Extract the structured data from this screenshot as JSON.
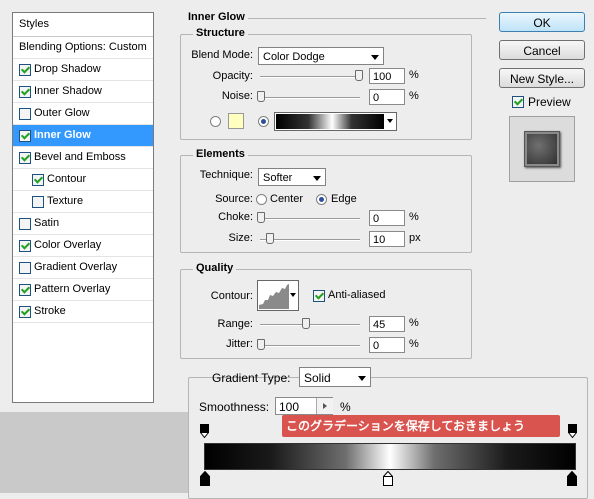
{
  "styles_panel": {
    "header": "Styles",
    "items": [
      {
        "label": "Blending Options: Custom",
        "checkbox": false,
        "checked": false,
        "indent": 0,
        "selected": false
      },
      {
        "label": "Drop Shadow",
        "checkbox": true,
        "checked": true,
        "indent": 1,
        "selected": false
      },
      {
        "label": "Inner Shadow",
        "checkbox": true,
        "checked": true,
        "indent": 1,
        "selected": false
      },
      {
        "label": "Outer Glow",
        "checkbox": true,
        "checked": false,
        "indent": 1,
        "selected": false
      },
      {
        "label": "Inner Glow",
        "checkbox": true,
        "checked": true,
        "indent": 1,
        "selected": true
      },
      {
        "label": "Bevel and Emboss",
        "checkbox": true,
        "checked": true,
        "indent": 1,
        "selected": false
      },
      {
        "label": "Contour",
        "checkbox": true,
        "checked": true,
        "indent": 2,
        "selected": false
      },
      {
        "label": "Texture",
        "checkbox": true,
        "checked": false,
        "indent": 2,
        "selected": false
      },
      {
        "label": "Satin",
        "checkbox": true,
        "checked": false,
        "indent": 1,
        "selected": false
      },
      {
        "label": "Color Overlay",
        "checkbox": true,
        "checked": true,
        "indent": 1,
        "selected": false
      },
      {
        "label": "Gradient Overlay",
        "checkbox": true,
        "checked": false,
        "indent": 1,
        "selected": false
      },
      {
        "label": "Pattern Overlay",
        "checkbox": true,
        "checked": true,
        "indent": 1,
        "selected": false
      },
      {
        "label": "Stroke",
        "checkbox": true,
        "checked": true,
        "indent": 1,
        "selected": false
      }
    ]
  },
  "inner_glow": {
    "title": "Inner Glow",
    "structure": {
      "title": "Structure",
      "blend_mode_label": "Blend Mode:",
      "blend_mode_value": "Color Dodge",
      "opacity_label": "Opacity:",
      "opacity_value": "100",
      "opacity_unit": "%",
      "noise_label": "Noise:",
      "noise_value": "0",
      "noise_unit": "%",
      "solid_color": "#ffffc0"
    },
    "elements": {
      "title": "Elements",
      "technique_label": "Technique:",
      "technique_value": "Softer",
      "source_label": "Source:",
      "source_center": "Center",
      "source_edge": "Edge",
      "choke_label": "Choke:",
      "choke_value": "0",
      "choke_unit": "%",
      "size_label": "Size:",
      "size_value": "10",
      "size_unit": "px"
    },
    "quality": {
      "title": "Quality",
      "contour_label": "Contour:",
      "anti_aliased_label": "Anti-aliased",
      "range_label": "Range:",
      "range_value": "45",
      "range_unit": "%",
      "jitter_label": "Jitter:",
      "jitter_value": "0",
      "jitter_unit": "%"
    }
  },
  "buttons": {
    "ok": "OK",
    "cancel": "Cancel",
    "new_style": "New Style...",
    "preview": "Preview"
  },
  "gradient_editor": {
    "type_label": "Gradient Type:",
    "type_value": "Solid",
    "smoothness_label": "Smoothness:",
    "smoothness_value": "100",
    "smoothness_unit": "%",
    "annotation": "このグラデーションを保存しておきましょう"
  }
}
